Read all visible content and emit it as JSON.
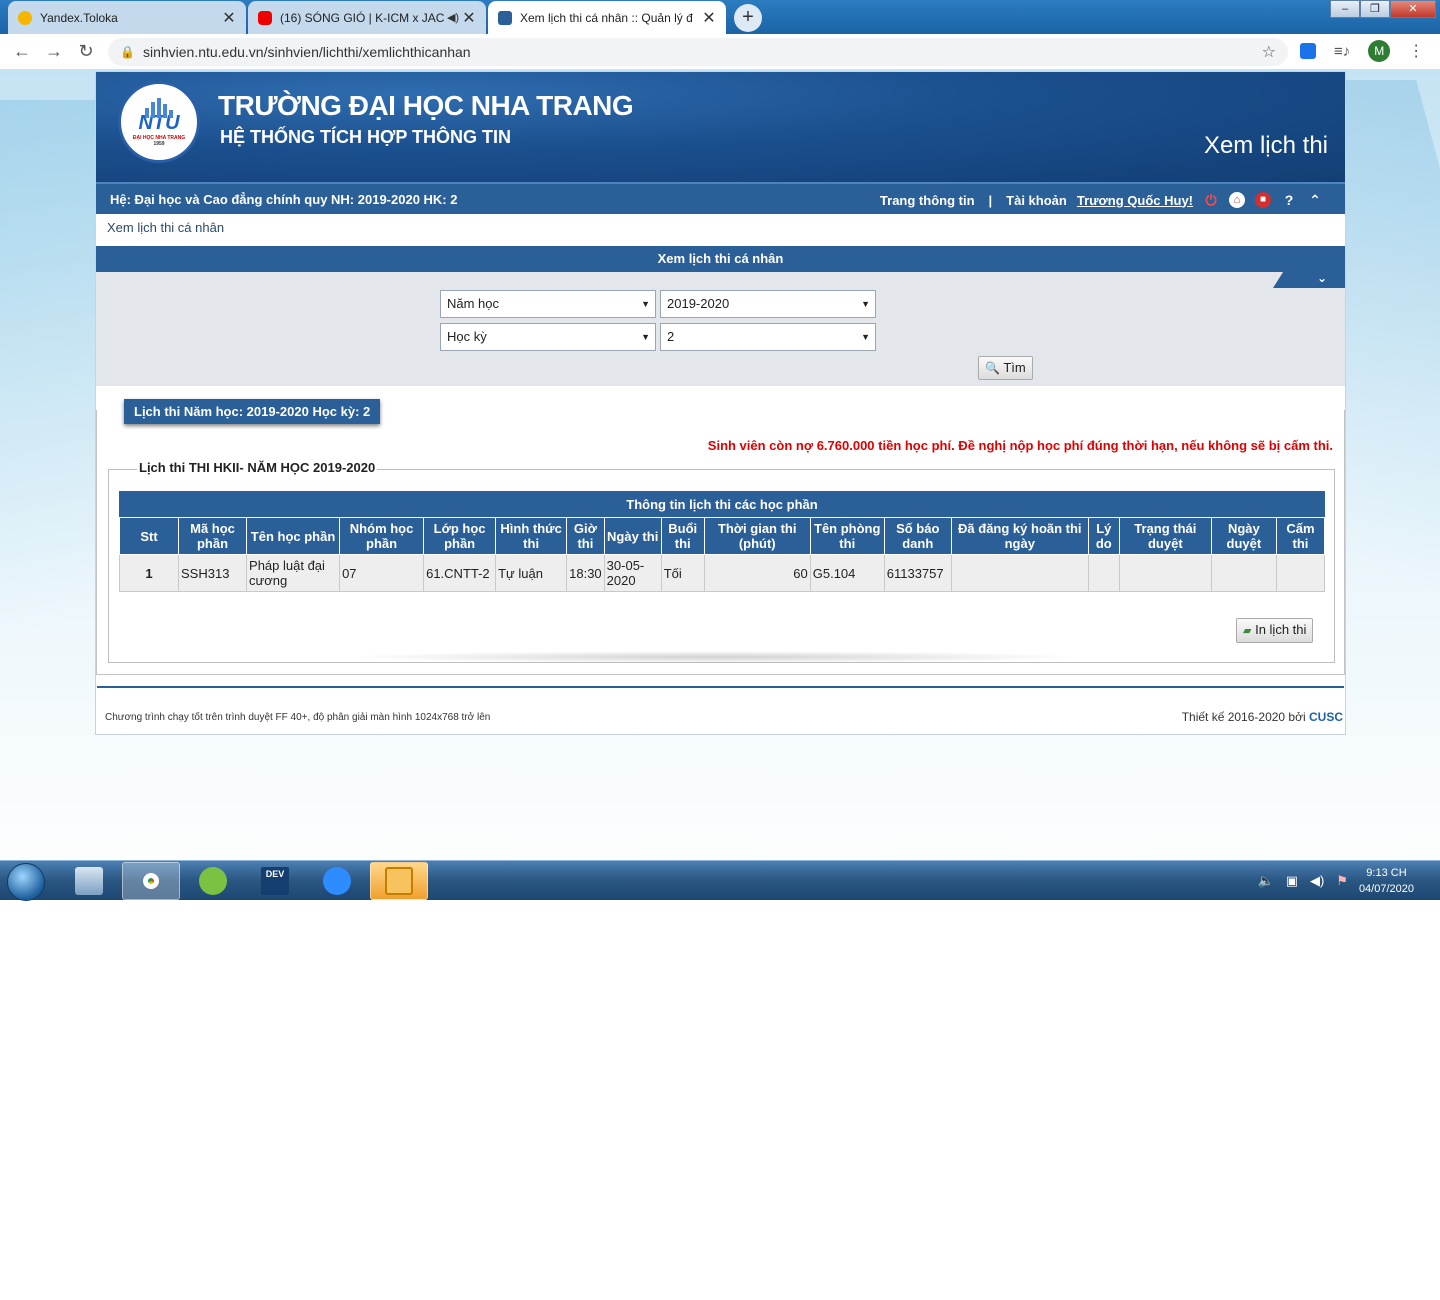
{
  "browser": {
    "tabs": [
      {
        "title": "Yandex.Toloka",
        "active": false
      },
      {
        "title": "(16) SÓNG GIÓ | K-ICM x JAC",
        "active": false
      },
      {
        "title": "Xem lịch thi cá nhân :: Quản lý đ",
        "active": true
      }
    ],
    "url": "sinhvien.ntu.edu.vn/sinhvien/lichthi/xemlichthicanhan",
    "profile_initial": "M"
  },
  "header": {
    "title": "TRƯỜNG ĐẠI HỌC NHA TRANG",
    "subtitle": "HỆ THỐNG TÍCH HỢP THÔNG TIN",
    "page_name": "Xem lịch thi",
    "logo_text": "NTU",
    "logo_caption": "ĐẠI HỌC NHA TRANG",
    "logo_year": "1959"
  },
  "infobar": {
    "left": "Hệ: Đại học và Cao đẳng chính quy  NH: 2019-2020  HK: 2",
    "home_link": "Trang thông tin",
    "separator": "|",
    "account_label": "Tài khoản",
    "account_name": "Trương Quốc Huy!"
  },
  "breadcrumb": "Xem lịch thi cá nhân",
  "panel": {
    "heading": "Xem lịch thi cá nhân",
    "filters": [
      {
        "label": "Năm học",
        "value": "2019-2020"
      },
      {
        "label": "Học kỳ",
        "value": "2"
      }
    ],
    "search_label": "Tìm"
  },
  "results": {
    "tab_title": "Lịch thi Năm học: 2019-2020 Học kỳ: 2",
    "warning": "Sinh viên còn nợ 6.760.000 tiền học phí. Đề nghị nộp học phí đúng thời hạn, nếu không sẽ bị cấm thi.",
    "group_title": "Lịch thi THI HKII- NĂM HỌC 2019-2020",
    "table_title": "Thông tin lịch thi các học phần",
    "columns": [
      "Stt",
      "Mã học phần",
      "Tên học phần",
      "Nhóm học phần",
      "Lớp học phần",
      "Hình thức thi",
      "Giờ thi",
      "Ngày thi",
      "Buổi thi",
      "Thời gian thi (phút)",
      "Tên phòng thi",
      "Số báo danh",
      "Đã đăng ký hoãn thi ngày",
      "Lý do",
      "Trạng thái duyệt",
      "Ngày duyệt",
      "Cấm thi"
    ],
    "rows": [
      [
        "1",
        "SSH313",
        "Pháp luật đại cương",
        "07",
        "61.CNTT-2",
        "Tự luận",
        "18:30",
        "30-05-2020",
        "Tối",
        "60",
        "G5.104",
        "61133757",
        "",
        "",
        "",
        "",
        ""
      ]
    ],
    "print_label": "In lịch thi"
  },
  "footer": {
    "left": "Chương trình chạy tốt trên trình duyệt FF 40+, độ phân giải màn hình 1024x768 trở lên",
    "right_prefix": "Thiết kế 2016-2020 bởi",
    "right_brand": "CUSC"
  },
  "taskbar": {
    "time": "9:13 CH",
    "date": "04/07/2020"
  }
}
